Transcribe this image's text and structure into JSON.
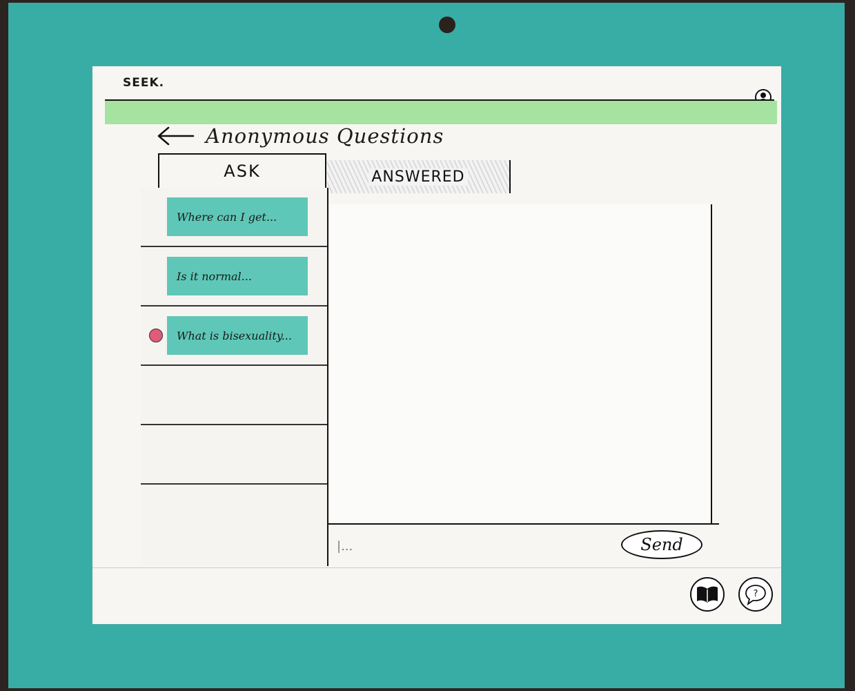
{
  "app": {
    "name": "SEEK."
  },
  "header": {
    "back_label": "back",
    "title": "Anonymous Questions"
  },
  "tabs": [
    {
      "label": "ASK"
    },
    {
      "label": "ANSWERED",
      "active": true
    }
  ],
  "questions": [
    {
      "text": "Where can I get...",
      "unread": false
    },
    {
      "text": "Is it normal...",
      "unread": false
    },
    {
      "text": "What is bisexuality...",
      "unread": true
    },
    {
      "text": "",
      "unread": false
    },
    {
      "text": "",
      "unread": false
    },
    {
      "text": "",
      "unread": false
    }
  ],
  "composer": {
    "value": "|...",
    "send_label": "Send"
  },
  "footer": {
    "icons": [
      "book-icon",
      "help-bubble-icon"
    ]
  },
  "colors": {
    "board": "#38ada6",
    "accent_bar": "#a6e3a1",
    "question_card": "#5fc7b7",
    "unread_dot": "#e25a78"
  }
}
